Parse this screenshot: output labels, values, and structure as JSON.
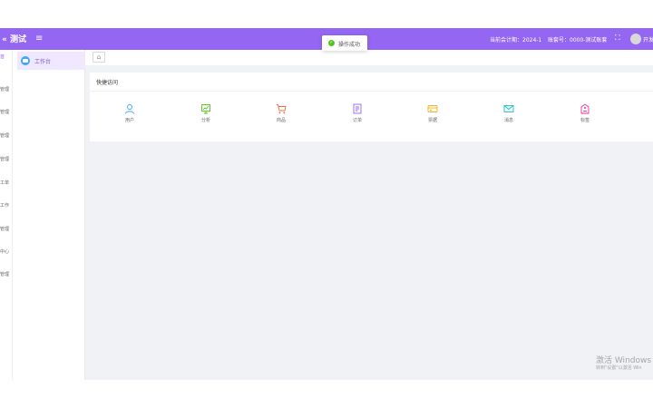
{
  "header": {
    "logo": "« 测试",
    "menu_toggle_icon": "hamburger-icon",
    "period": "当前会计期：2024-1",
    "account": "账套号：0000-测试账套",
    "fullscreen_icon": "fullscreen-icon",
    "username": "开发",
    "color": "#9466f2"
  },
  "toast": {
    "text": "操作成功",
    "icon": "success-check-icon",
    "icon_color": "#52c41a"
  },
  "left_strip": {
    "items": [
      {
        "label": "首",
        "active": true
      },
      {
        "label": "管理"
      },
      {
        "label": "管理"
      },
      {
        "label": "管理"
      },
      {
        "label": "管理"
      },
      {
        "label": "工单"
      },
      {
        "label": "工作"
      },
      {
        "label": "管理"
      },
      {
        "label": "中心"
      },
      {
        "label": "管理"
      }
    ]
  },
  "sidebar": {
    "items": [
      {
        "label": "工作台",
        "icon": "workbench-icon",
        "active": true
      }
    ]
  },
  "tabs": {
    "home_icon": "home-icon"
  },
  "quick_access": {
    "title": "快捷访问",
    "items": [
      {
        "label": "用户",
        "icon": "user-icon",
        "color": "#3ba7ff"
      },
      {
        "label": "分析",
        "icon": "analysis-icon",
        "color": "#52c41a"
      },
      {
        "label": "商品",
        "icon": "cart-icon",
        "color": "#fa6b3c"
      },
      {
        "label": "订单",
        "icon": "order-icon",
        "color": "#9466f2"
      },
      {
        "label": "票据",
        "icon": "card-icon",
        "color": "#faad14"
      },
      {
        "label": "消息",
        "icon": "mail-icon",
        "color": "#13c2c2"
      },
      {
        "label": "标签",
        "icon": "tag-icon",
        "color": "#eb2f96"
      }
    ]
  },
  "watermark": {
    "title": "激活 Windows",
    "subtitle": "转到\"设置\"以激活 Win"
  }
}
